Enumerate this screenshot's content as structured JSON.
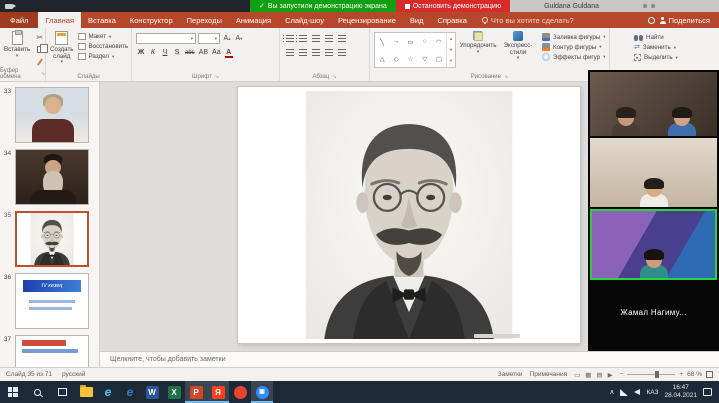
{
  "meeting_bar": {
    "share_status": "Вы запустили демонстрацию экрана",
    "stop_button_label": "Остановить демонстрацию",
    "user_name": "Guldana Guldana"
  },
  "menu_bar": {
    "file_tab": "Файл",
    "tabs": [
      "Главная",
      "Вставка",
      "Конструктор",
      "Переходы",
      "Анимация",
      "Слайд-шоу",
      "Рецензирование",
      "Вид",
      "Справка"
    ],
    "tell_me": "Что вы хотите сделать?",
    "share_label": "Поделиться"
  },
  "ribbon": {
    "group_labels": {
      "clipboard": "Буфер обмена",
      "slides": "Слайды",
      "font": "Шрифт",
      "paragraph": "Абзац",
      "drawing": "Рисование"
    },
    "paste_label": "Вставить",
    "new_slide_label": "Создать слайд",
    "layout_label": "Макет",
    "reset_label": "Восстановить",
    "section_label": "Раздел",
    "bold_label": "Ж",
    "italic_label": "К",
    "underline_label": "Ч",
    "strike_label": "abc",
    "shadow_label": "S",
    "spacing_label": "АВ",
    "case_label": "Аа",
    "grow_font_label": "А",
    "shrink_font_label": "А",
    "font_color_label": "А",
    "arrange_label": "Упорядочить",
    "quick_styles_label": "Экспресс-стили",
    "shape_fill_label": "Заливка фигуры",
    "shape_outline_label": "Контур фигуры",
    "shape_effects_label": "Эффекты фигур",
    "find_label": "Найти",
    "replace_label": "Заменить",
    "select_label": "Выделить"
  },
  "slides_panel": {
    "thumbnails": [
      {
        "number": "33"
      },
      {
        "number": "34"
      },
      {
        "number": "35"
      },
      {
        "number": "36",
        "caption": "IV кезең"
      },
      {
        "number": "37"
      }
    ]
  },
  "notes_bar": {
    "placeholder": "Щелкните, чтобы добавить заметки"
  },
  "status_bar": {
    "slide_info": "Слайд 35 из 71",
    "language": "русский",
    "notes_label": "Заметки",
    "comments_label": "Примечания",
    "zoom_level": "68 %"
  },
  "video_panel": {
    "active_participant": "Жамал Нагиму..."
  },
  "taskbar": {
    "language": "КАЗ",
    "time": "16:47",
    "date": "28.04.2021"
  },
  "colors": {
    "ppt_red": "#b7472a",
    "meeting_green": "#11a011",
    "meeting_red": "#d92a2a",
    "active_speaker_green": "#27d245"
  }
}
